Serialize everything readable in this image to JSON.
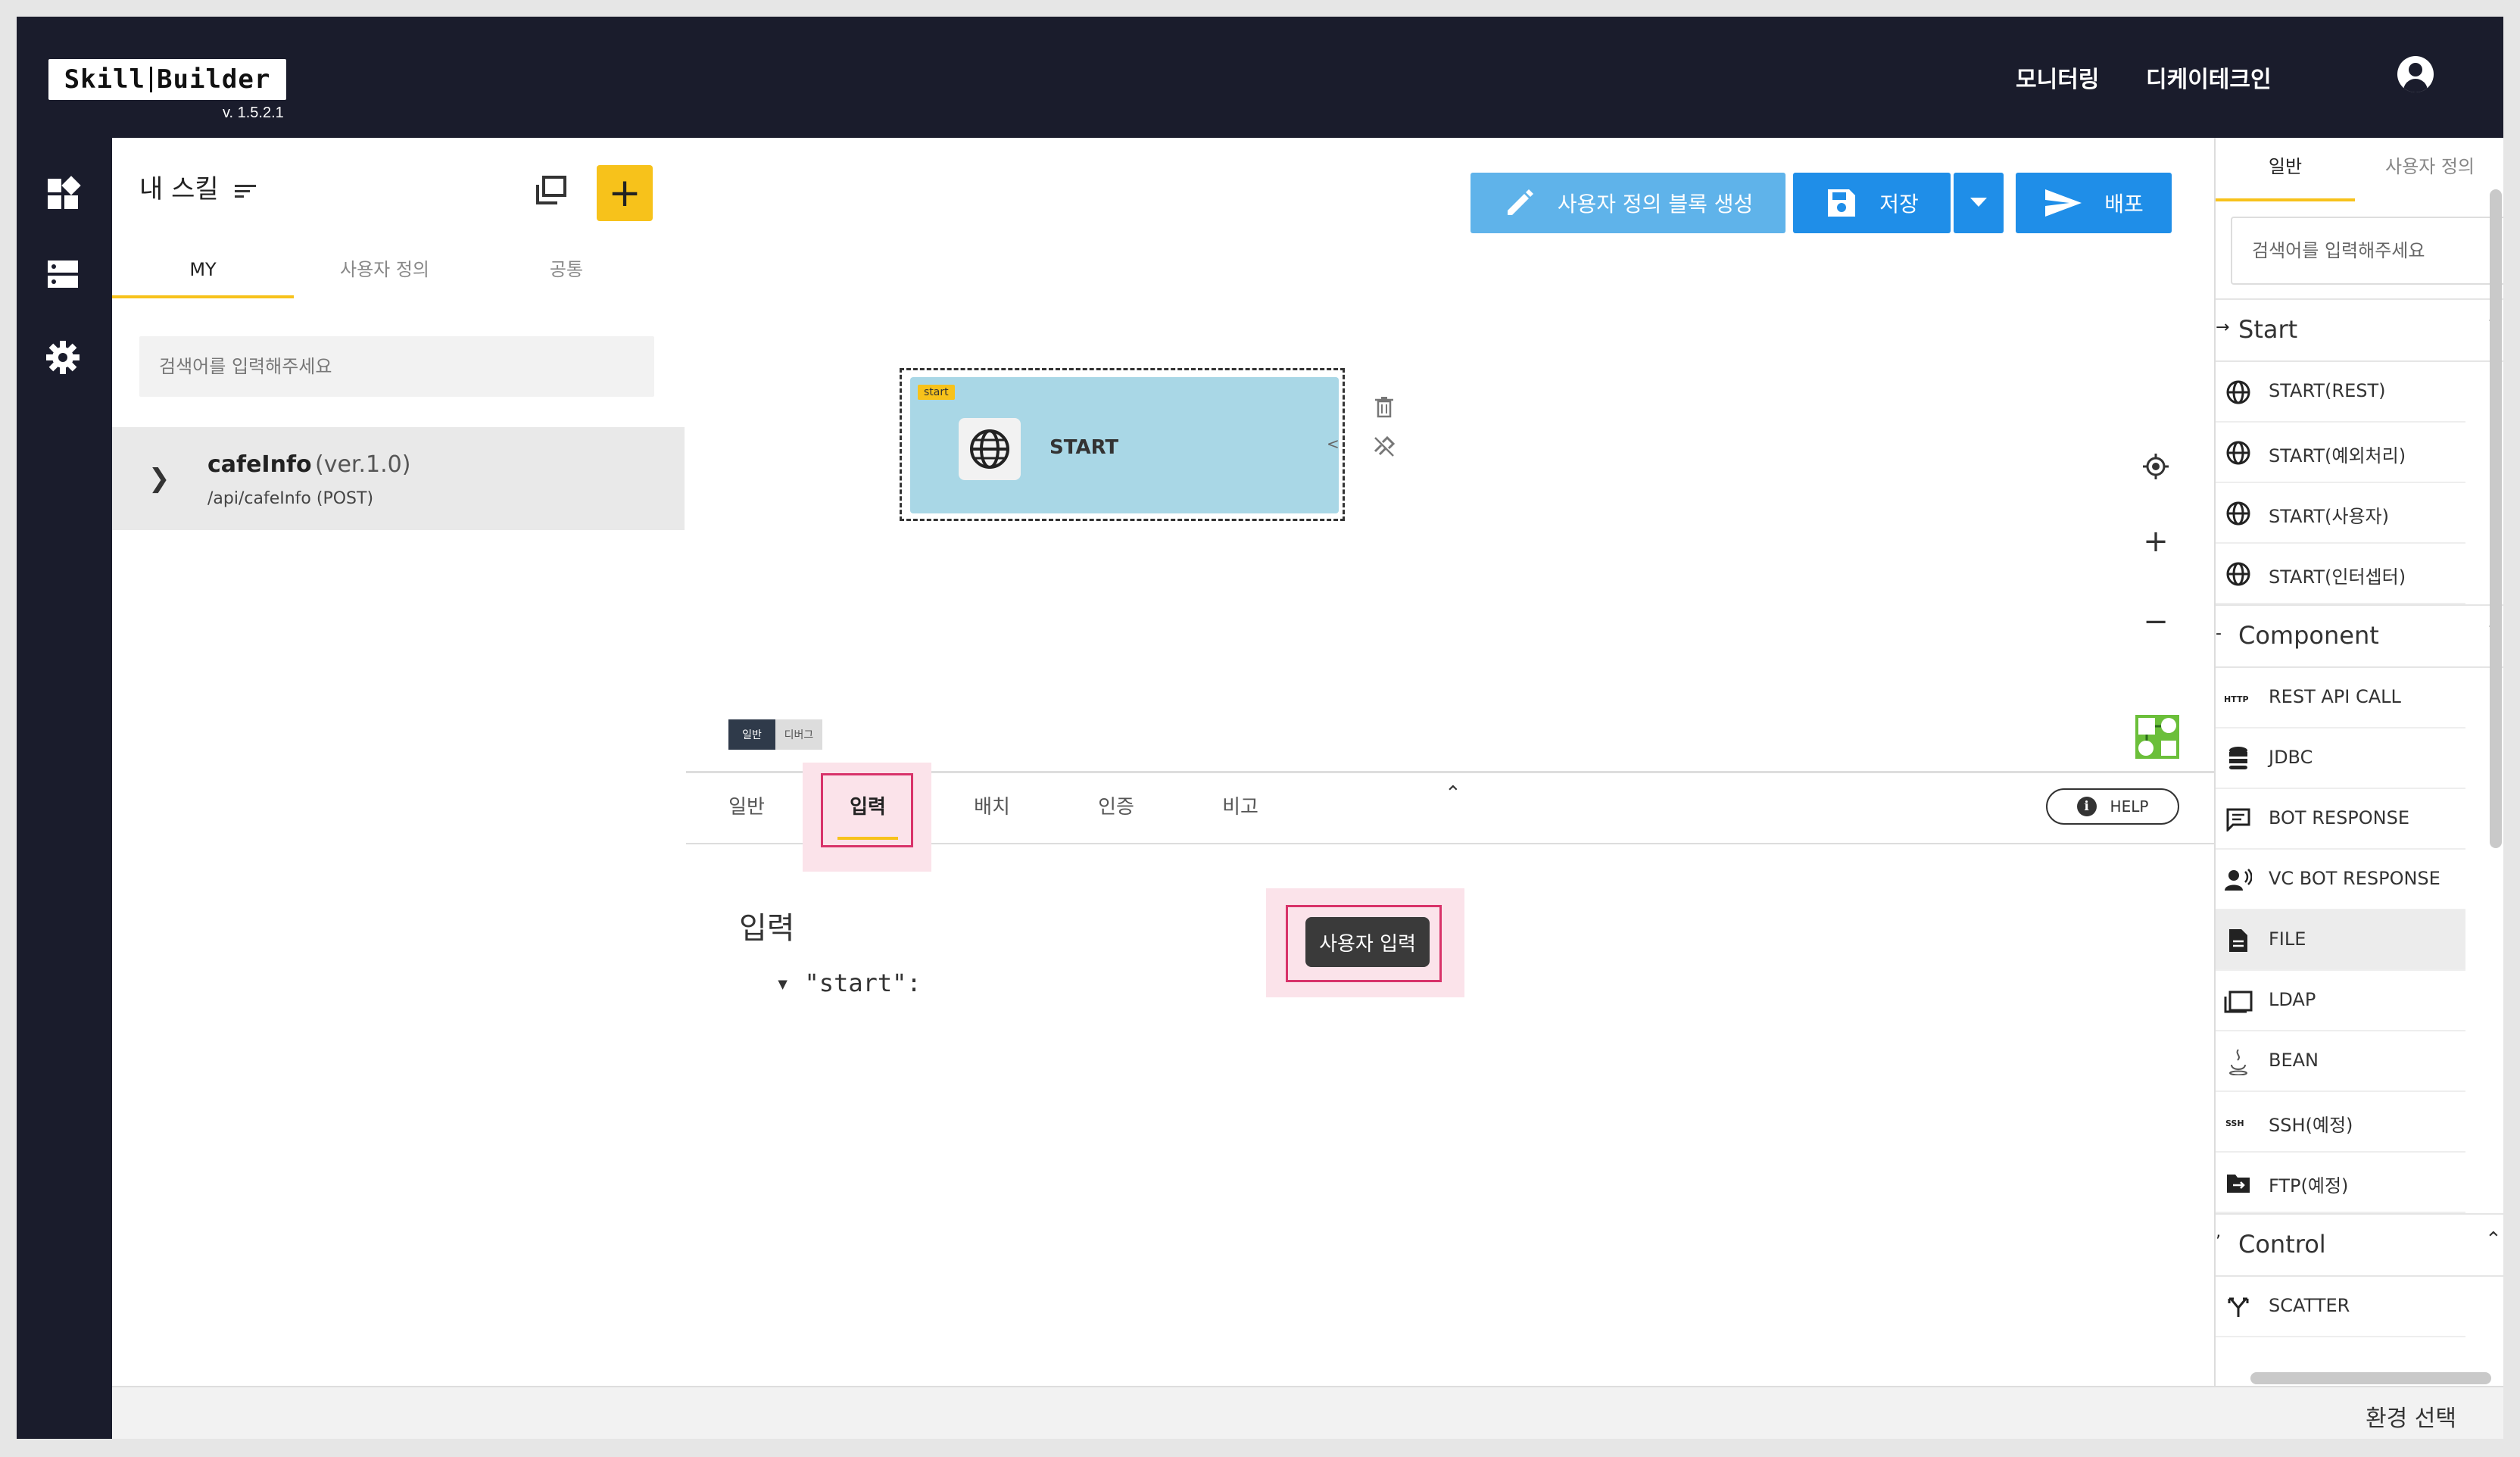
{
  "app": {
    "logo_left": "Skill",
    "logo_right": "Builder",
    "version": "v. 1.5.2.1"
  },
  "header": {
    "nav": [
      "모니터링",
      "디케이테크인"
    ]
  },
  "left_panel": {
    "title": "내 스킬",
    "tabs": [
      "MY",
      "사용자 정의",
      "공통"
    ],
    "active_tab": "MY",
    "search_placeholder": "검색어를 입력해주세요",
    "skills": [
      {
        "name": "cafeInfo",
        "version": "(ver.1.0)",
        "path": "/api/cafeInfo (POST)"
      }
    ]
  },
  "toolbar": {
    "custom_block_label": "사용자 정의 블록 생성",
    "save_label": "저장",
    "deploy_label": "배포",
    "colors": {
      "custom": "#5fb3ea",
      "save": "#1f8ee8",
      "deploy": "#1f8ee8"
    }
  },
  "canvas": {
    "node": {
      "tag": "start",
      "label": "START"
    },
    "mode_toggle": [
      "일반",
      "디버그"
    ]
  },
  "bottom_panel": {
    "tabs": [
      "일반",
      "입력",
      "배치",
      "인증",
      "비고"
    ],
    "active_tab": "입력",
    "help_label": "HELP",
    "section_title": "입력",
    "tree_line": "▾ \"start\":",
    "user_input_button": "사용자 입력",
    "highlight_color": "#d8336a"
  },
  "right_panel": {
    "tabs": [
      "일반",
      "사용자 정의"
    ],
    "active_tab": "일반",
    "search_placeholder": "검색어를 입력해주세요",
    "categories": [
      {
        "name": "Start",
        "items": [
          {
            "label": "START(REST)",
            "icon": "globe-icon"
          },
          {
            "label": "START(예외처리)",
            "icon": "globe-icon"
          },
          {
            "label": "START(사용자)",
            "icon": "globe-icon"
          },
          {
            "label": "START(인터셉터)",
            "icon": "globe-icon"
          }
        ]
      },
      {
        "name": "Component",
        "items": [
          {
            "label": "REST API CALL",
            "icon": "http-icon"
          },
          {
            "label": "JDBC",
            "icon": "database-icon"
          },
          {
            "label": "BOT RESPONSE",
            "icon": "message-icon"
          },
          {
            "label": "VC BOT RESPONSE",
            "icon": "voice-icon"
          },
          {
            "label": "FILE",
            "icon": "file-icon"
          },
          {
            "label": "LDAP",
            "icon": "folders-icon"
          },
          {
            "label": "BEAN",
            "icon": "java-icon"
          },
          {
            "label": "SSH(예정)",
            "icon": "ssh-icon"
          },
          {
            "label": "FTP(예정)",
            "icon": "folder-icon"
          }
        ]
      },
      {
        "name": "Control",
        "items": [
          {
            "label": "SCATTER",
            "icon": "scatter-icon"
          }
        ]
      }
    ],
    "selected_item": "FILE"
  },
  "footer": {
    "env_label": "환경 선택"
  }
}
